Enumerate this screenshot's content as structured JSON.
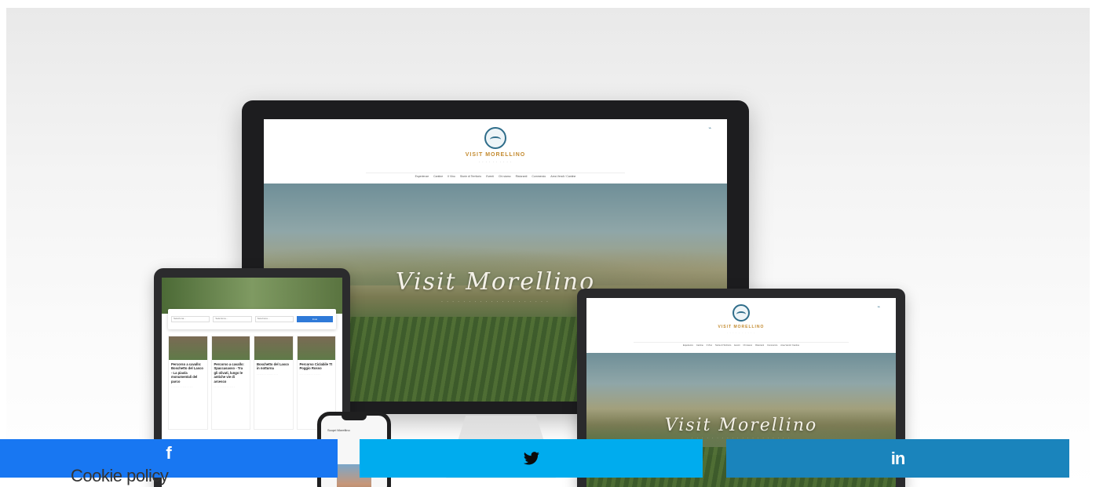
{
  "site": {
    "name": "VISIT MORELLINO",
    "tagline": "· · · · · · · · · ·",
    "nav": [
      "Esperienze",
      "Cantine",
      "Il Vino",
      "Storie di Territorio",
      "Eventi",
      "Chi siamo",
      "Ristoranti",
      "Commercio",
      "Area Vendi / Cantine"
    ],
    "hero_title": "Visit Morellino",
    "hero_subtitle": "· · · · · · · · · · · · · · · · · · · ·"
  },
  "tablet": {
    "search_fields": [
      "Seleziona…",
      "Seleziona…",
      "Seleziona…"
    ],
    "search_button": "Invio",
    "cards": [
      {
        "title": "Percorso a cavallo: Boschetto del Lasco - La piaola monumentali del parco",
        "text": "· · · · · · · · · · · · · · ·"
      },
      {
        "title": "Percorso a cavallo: Spaccasasso - Tra gli olivati, lungo le antiche vie di arcesco",
        "text": "· · · · · · · · · · · · · · ·"
      },
      {
        "title": "Boschetto del Lasco in notturna",
        "text": "· · · · · · · · · · · · · · ·"
      },
      {
        "title": "Percorso Ciclabile Tt Poggio Rosso",
        "text": "· · · · · · · · · · · · · · ·"
      }
    ]
  },
  "phone": {
    "title": "Scopri Morellino"
  },
  "share": {
    "facebook_icon": "facebook-icon",
    "twitter_icon": "twitter-icon",
    "linkedin_icon": "linkedin-icon",
    "facebook_glyph": "f",
    "linkedin_glyph": "in",
    "colors": {
      "facebook": "#1877f2",
      "twitter": "#00acee",
      "linkedin": "#1a84bc"
    }
  },
  "cookie_label": "Cookie policy"
}
